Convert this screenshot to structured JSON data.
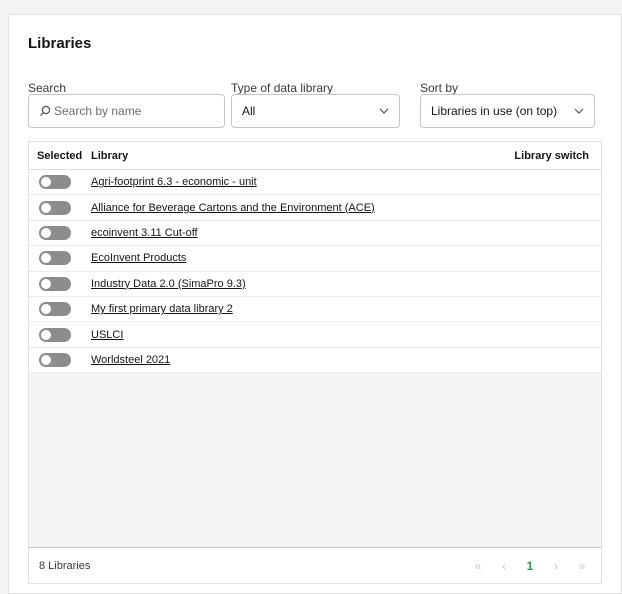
{
  "title": "Libraries",
  "filters": {
    "search_label": "Search",
    "search_placeholder": "Search by name",
    "type_label": "Type of data library",
    "type_value": "All",
    "sort_label": "Sort by",
    "sort_value": "Libraries in use (on top)"
  },
  "table": {
    "headers": {
      "selected": "Selected",
      "library": "Library",
      "switch": "Library switch"
    },
    "rows": [
      {
        "library": "Agri-footprint 6.3 - economic - unit",
        "selected": false
      },
      {
        "library": "Alliance for Beverage Cartons and the Environment (ACE)",
        "selected": false
      },
      {
        "library": "ecoinvent 3.11 Cut-off",
        "selected": false
      },
      {
        "library": "EcoInvent Products",
        "selected": false
      },
      {
        "library": "Industry Data 2.0 (SimaPro 9.3)",
        "selected": false
      },
      {
        "library": "My first primary data library 2",
        "selected": false
      },
      {
        "library": "USLCI",
        "selected": false
      },
      {
        "library": "Worldsteel 2021",
        "selected": false
      }
    ]
  },
  "footer": {
    "count_text": "8 Libraries",
    "first_icon": "«",
    "prev_icon": "‹",
    "current_page": "1",
    "next_icon": "›",
    "last_icon": "»"
  },
  "colors": {
    "accent_page": "#24a148",
    "toggle_off": "#8d8d8d"
  }
}
